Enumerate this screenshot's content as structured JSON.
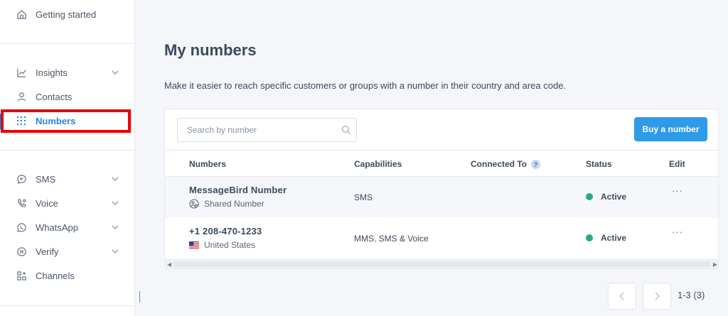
{
  "sidebar": {
    "getting_started": "Getting started",
    "items": [
      {
        "label": "Insights",
        "icon": "line-chart-icon"
      },
      {
        "label": "Contacts",
        "icon": "person-icon"
      },
      {
        "label": "Numbers",
        "icon": "dial-pad-icon"
      },
      {
        "label": "SMS",
        "icon": "chat-bubble-icon"
      },
      {
        "label": "Voice",
        "icon": "phone-icon"
      },
      {
        "label": "WhatsApp",
        "icon": "whatsapp-icon"
      },
      {
        "label": "Verify",
        "icon": "badge-icon"
      },
      {
        "label": "Channels",
        "icon": "grid-plus-icon"
      }
    ],
    "active_item": "Numbers"
  },
  "main": {
    "title": "My numbers",
    "description": "Make it easier to reach specific customers or groups with a number in their country and area code.",
    "search_placeholder": "Search by number",
    "buy_button": "Buy a number",
    "columns": [
      "Numbers",
      "Capabilities",
      "Connected To",
      "Status",
      "Edit"
    ],
    "connected_help": "?",
    "rows": [
      {
        "number": "MessageBird Number",
        "sub": "Shared Number",
        "capabilities": "SMS",
        "connected_to": "",
        "status": "Active",
        "edit": "···"
      },
      {
        "number": "+1 208-470-1233",
        "sub": "United States",
        "capabilities": "MMS, SMS & Voice",
        "connected_to": "",
        "status": "Active",
        "edit": "···"
      }
    ],
    "pagination": "1-3 (3)"
  },
  "colors": {
    "accent": "#2f9ae8",
    "active_text": "#1f87e5",
    "status_active": "#2aa88a",
    "highlight": "#e60000"
  }
}
